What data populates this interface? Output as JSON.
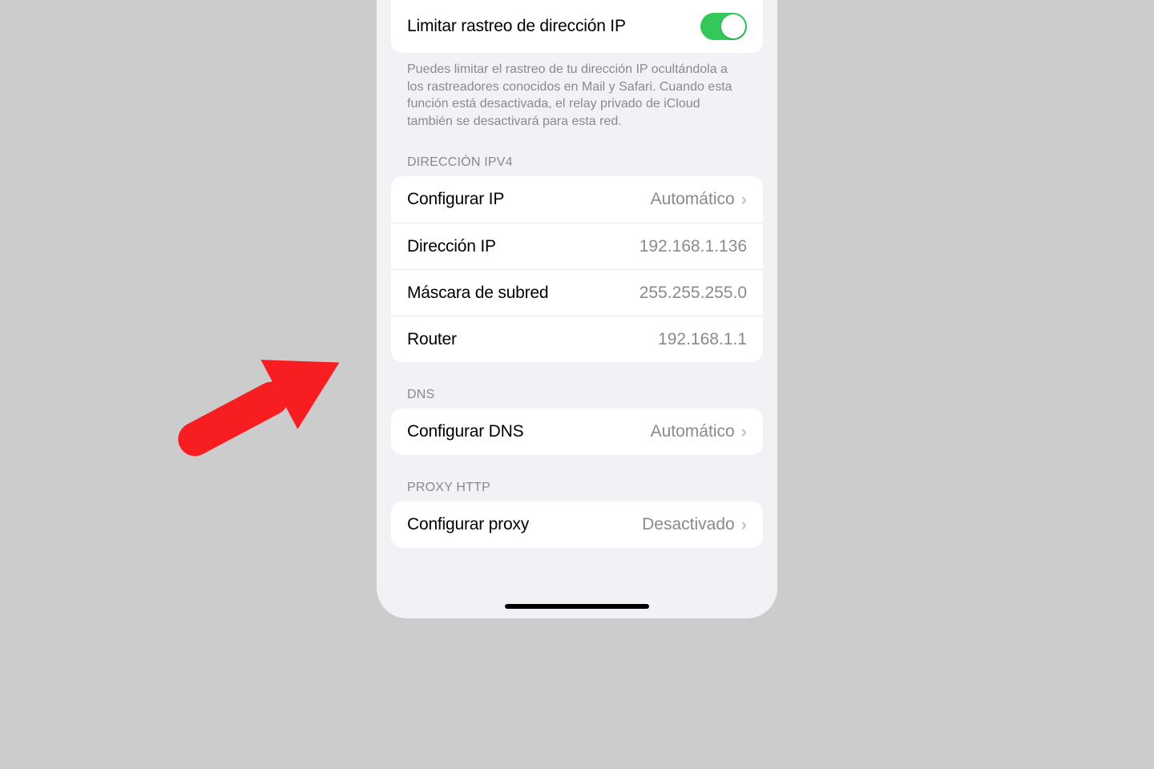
{
  "tracking_row": {
    "label": "Limitar rastreo de dirección IP",
    "toggle_on": true
  },
  "tracking_footer": "Puedes limitar el rastreo de tu dirección IP ocultándola a los rastreadores conocidos en Mail y Safari. Cuando esta función está desactivada, el relay privado de iCloud también se desactivará para esta red.",
  "ipv4": {
    "header": "DIRECCIÓN IPV4",
    "configure_ip": {
      "label": "Configurar IP",
      "value": "Automático"
    },
    "ip_address": {
      "label": "Dirección IP",
      "value": "192.168.1.136"
    },
    "subnet_mask": {
      "label": "Máscara de subred",
      "value": "255.255.255.0"
    },
    "router": {
      "label": "Router",
      "value": "192.168.1.1"
    }
  },
  "dns": {
    "header": "DNS",
    "configure_dns": {
      "label": "Configurar DNS",
      "value": "Automático"
    }
  },
  "proxy": {
    "header": "PROXY HTTP",
    "configure_proxy": {
      "label": "Configurar proxy",
      "value": "Desactivado"
    }
  },
  "annotation": {
    "arrow_color": "#f81d21"
  }
}
